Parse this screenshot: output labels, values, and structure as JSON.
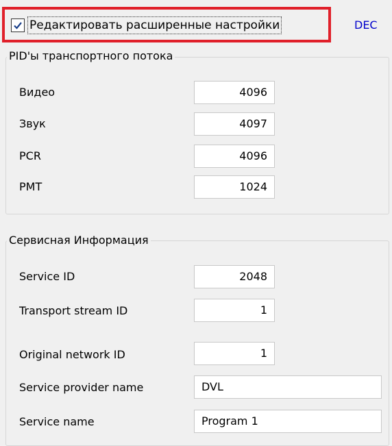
{
  "header": {
    "checkbox_label": "Редактировать расширенные настройки",
    "checkbox_checked": true,
    "dec_link": "DEC"
  },
  "pid_group": {
    "title": "PID'ы транспортного потока",
    "fields": [
      {
        "label": "Видео",
        "value": "4096"
      },
      {
        "label": "Звук",
        "value": "4097"
      },
      {
        "label": "PCR",
        "value": "4096"
      },
      {
        "label": "PMT",
        "value": "1024"
      }
    ]
  },
  "service_group": {
    "title": "Сервисная Информация",
    "fields": [
      {
        "label": "Service ID",
        "value": "2048"
      },
      {
        "label": "Transport stream ID",
        "value": "1"
      },
      {
        "label": "Original network ID",
        "value": "1"
      },
      {
        "label": "Service provider name",
        "value": "DVL"
      },
      {
        "label": "Service name",
        "value": "Program 1"
      }
    ]
  },
  "colors": {
    "highlight_border": "#e0202a",
    "link": "#0000cc",
    "panel_bg": "#f0f0f0"
  }
}
